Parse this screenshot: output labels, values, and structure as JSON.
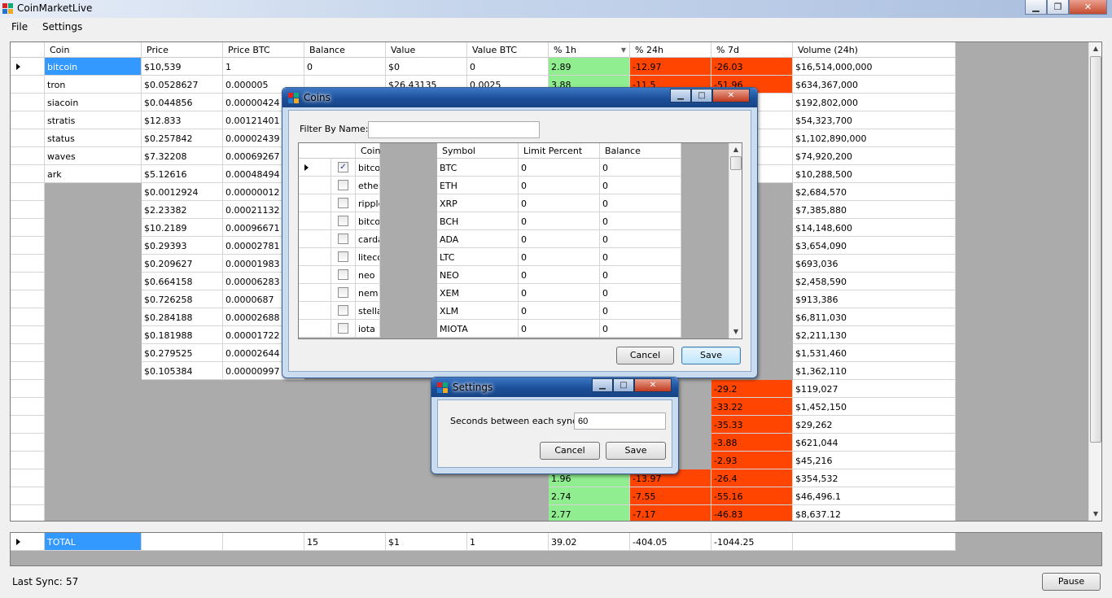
{
  "window": {
    "title": "CoinMarketLive"
  },
  "menu": [
    "File",
    "Settings"
  ],
  "main_grid": {
    "columns": [
      "Coin",
      "Price",
      "Price BTC",
      "Balance",
      "Value",
      "Value BTC",
      "% 1h",
      "% 24h",
      "% 7d",
      "Volume (24h)"
    ],
    "rows": [
      [
        "bitcoin",
        "$10,539",
        "1",
        "0",
        "$0",
        "0",
        "2.89",
        "-12.97",
        "-26.03",
        "$16,514,000,000"
      ],
      [
        "tron",
        "$0.0528627",
        "0.000005",
        "",
        "$26.43135",
        "0.0025",
        "3.88",
        "-11.5",
        "-51.96",
        "$634,367,000"
      ],
      [
        "siacoin",
        "$0.044856",
        "0.00000424",
        "",
        "",
        "",
        "",
        "",
        "",
        "$192,802,000"
      ],
      [
        "stratis",
        "$12.833",
        "0.00121401",
        "",
        "",
        "",
        "",
        "",
        "",
        "$54,323,700"
      ],
      [
        "status",
        "$0.257842",
        "0.00002439",
        "",
        "",
        "",
        "",
        "",
        "",
        "$1,102,890,000"
      ],
      [
        "waves",
        "$7.32208",
        "0.00069267",
        "",
        "",
        "",
        "",
        "",
        "",
        "$74,920,200"
      ],
      [
        "ark",
        "$5.12616",
        "0.00048494",
        "",
        "",
        "",
        "",
        "",
        "",
        "$10,288,500"
      ],
      [
        "",
        "$0.0012924",
        "0.00000012",
        "",
        "",
        "",
        "",
        "",
        "",
        "$2,684,570"
      ],
      [
        "",
        "$2.23382",
        "0.00021132",
        "",
        "",
        "",
        "",
        "",
        "",
        "$7,385,880"
      ],
      [
        "",
        "$10.2189",
        "0.00096671",
        "",
        "",
        "",
        "",
        "",
        "",
        "$14,148,600"
      ],
      [
        "",
        "$0.29393",
        "0.00002781",
        "",
        "",
        "",
        "",
        "",
        "",
        "$3,654,090"
      ],
      [
        "",
        "$0.209627",
        "0.00001983",
        "",
        "",
        "",
        "",
        "",
        "",
        "$693,036"
      ],
      [
        "",
        "$0.664158",
        "0.00006283",
        "",
        "",
        "",
        "",
        "",
        "",
        "$2,458,590"
      ],
      [
        "",
        "$0.726258",
        "0.0000687",
        "",
        "",
        "",
        "",
        "",
        "",
        "$913,386"
      ],
      [
        "",
        "$0.284188",
        "0.00002688",
        "",
        "",
        "",
        "",
        "",
        "",
        "$6,811,030"
      ],
      [
        "",
        "$0.181988",
        "0.00001722",
        "",
        "",
        "",
        "",
        "",
        "",
        "$2,211,130"
      ],
      [
        "",
        "$0.279525",
        "0.00002644",
        "",
        "",
        "",
        "",
        "",
        "",
        "$1,531,460"
      ],
      [
        "",
        "$0.105384",
        "0.00000997",
        "",
        "",
        "",
        "",
        "",
        "",
        "$1,362,110"
      ],
      [
        "",
        "",
        "",
        "",
        "",
        "",
        "",
        "",
        "-29.2",
        "$119,027"
      ],
      [
        "",
        "",
        "",
        "",
        "",
        "",
        "",
        "",
        "-33.22",
        "$1,452,150"
      ],
      [
        "",
        "",
        "",
        "",
        "",
        "",
        "",
        "",
        "-35.33",
        "$29,262"
      ],
      [
        "",
        "",
        "",
        "",
        "",
        "",
        "",
        "",
        "-3.88",
        "$621,044"
      ],
      [
        "",
        "",
        "",
        "",
        "",
        "",
        "",
        "",
        "-2.93",
        "$45,216"
      ],
      [
        "",
        "",
        "",
        "",
        "",
        "",
        "1.96",
        "-13.97",
        "-26.4",
        "$354,532"
      ],
      [
        "",
        "",
        "",
        "",
        "",
        "",
        "2.74",
        "-7.55",
        "-55.16",
        "$46,496.1"
      ],
      [
        "",
        "",
        "",
        "",
        "",
        "",
        "2.77",
        "-7.17",
        "-46.83",
        "$8,637.12"
      ]
    ],
    "cell_colors": {
      "pos": "#90ee90",
      "neg": "#ff4500",
      "selected": "#3399ff"
    }
  },
  "total_row": [
    "TOTAL",
    "",
    "",
    "15",
    "$1",
    "1",
    "39.02",
    "-404.05",
    "-1044.25",
    ""
  ],
  "coins_dialog": {
    "title": "Coins",
    "filter_label": "Filter By Name:",
    "filter_value": "",
    "columns": [
      "Coin",
      "Symbol",
      "Limit Percent",
      "Balance"
    ],
    "rows": [
      {
        "checked": true,
        "coin": "bitcoin",
        "symbol": "BTC",
        "limit": "0",
        "balance": "0"
      },
      {
        "checked": false,
        "coin": "ethereum",
        "symbol": "ETH",
        "limit": "0",
        "balance": "0"
      },
      {
        "checked": false,
        "coin": "ripple",
        "symbol": "XRP",
        "limit": "0",
        "balance": "0"
      },
      {
        "checked": false,
        "coin": "bitcoin-cash",
        "symbol": "BCH",
        "limit": "0",
        "balance": "0"
      },
      {
        "checked": false,
        "coin": "cardano",
        "symbol": "ADA",
        "limit": "0",
        "balance": "0"
      },
      {
        "checked": false,
        "coin": "litecoin",
        "symbol": "LTC",
        "limit": "0",
        "balance": "0"
      },
      {
        "checked": false,
        "coin": "neo",
        "symbol": "NEO",
        "limit": "0",
        "balance": "0"
      },
      {
        "checked": false,
        "coin": "nem",
        "symbol": "XEM",
        "limit": "0",
        "balance": "0"
      },
      {
        "checked": false,
        "coin": "stellar",
        "symbol": "XLM",
        "limit": "0",
        "balance": "0"
      },
      {
        "checked": false,
        "coin": "iota",
        "symbol": "MIOTA",
        "limit": "0",
        "balance": "0"
      }
    ],
    "cancel_label": "Cancel",
    "save_label": "Save"
  },
  "settings_dialog": {
    "title": "Settings",
    "sync_label": "Seconds between each sync:",
    "sync_value": "60",
    "cancel_label": "Cancel",
    "save_label": "Save"
  },
  "status": {
    "label": "Last Sync:",
    "value": "57"
  },
  "pause_label": "Pause"
}
